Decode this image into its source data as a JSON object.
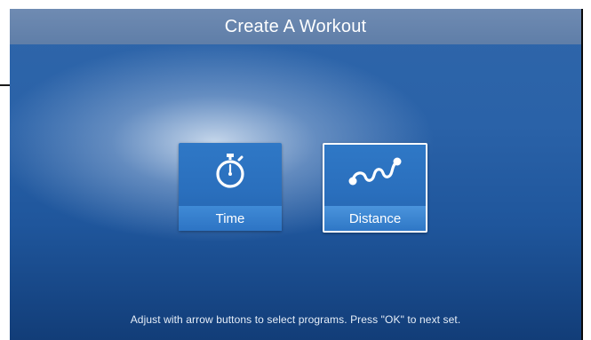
{
  "header": {
    "title": "Create A Workout"
  },
  "tiles": [
    {
      "label": "Time",
      "icon": "stopwatch-icon",
      "selected": false
    },
    {
      "label": "Distance",
      "icon": "route-icon",
      "selected": true
    }
  ],
  "footer": {
    "hint": "Adjust with arrow buttons to select programs. Press \"OK\" to next set."
  },
  "colors": {
    "background": "#2a62a8",
    "title_bar": "#6f8bb2",
    "tile": "#2a6fbd",
    "text": "#ffffff"
  }
}
